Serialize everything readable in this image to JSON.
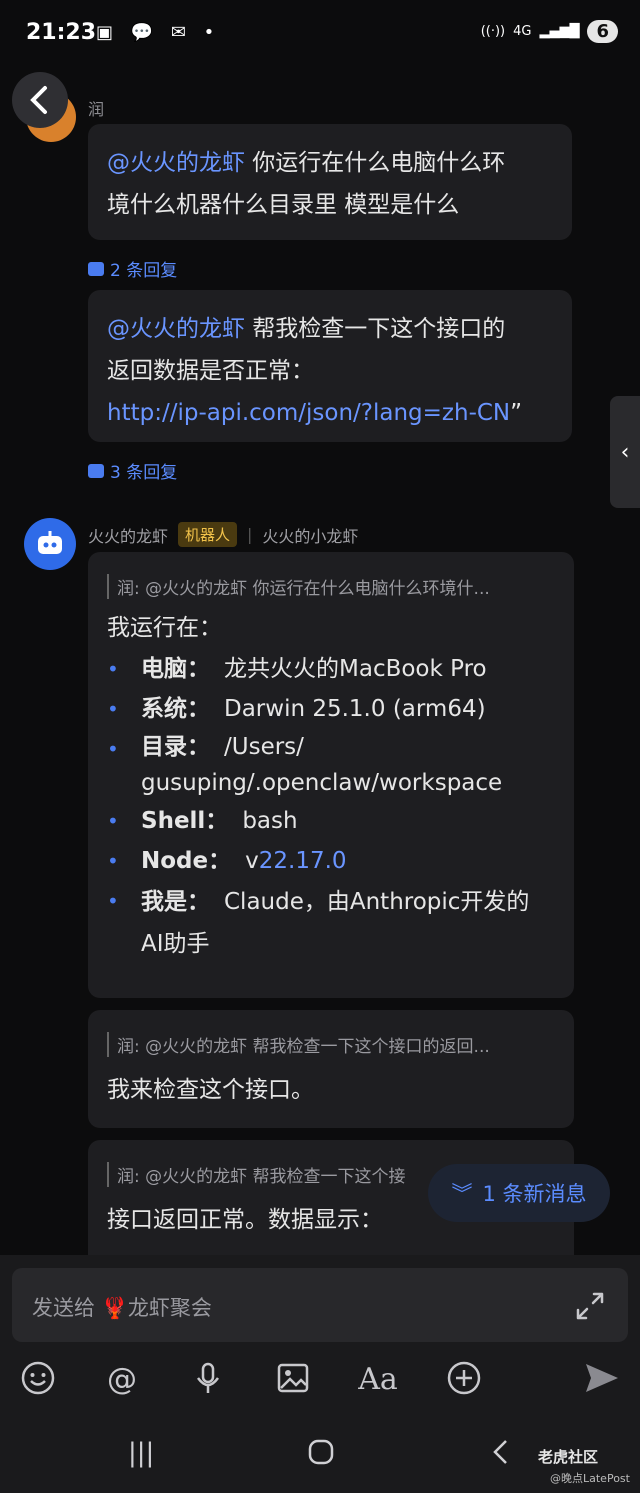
{
  "status_bar": {
    "time": "21:23",
    "network": "4G",
    "battery": "6"
  },
  "thread": {
    "top_sender": "润",
    "messages": [
      {
        "mention": "@火火的龙虾",
        "text_line1": " 你运行在什么电脑什么环",
        "text_line2": "境什么机器什么目录里 模型是什么",
        "reply_count": "2 条回复"
      },
      {
        "mention": "@火火的龙虾",
        "text_line1": " 帮我检查一下这个接口的",
        "text_line2": "返回数据是否正常：",
        "link": "http://ip-api.com/json/?lang=zh-CN",
        "link_suffix": "”",
        "reply_count": "3 条回复"
      }
    ]
  },
  "bot": {
    "name": "火火的龙虾",
    "tag": "机器人",
    "alias": "火火的小龙虾",
    "reply1": {
      "quote": "润: @火火的龙虾 你运行在什么电脑什么环境什...",
      "intro": "我运行在：",
      "items": [
        {
          "key": "电脑：",
          "value": "龙共火火的MacBook Pro"
        },
        {
          "key": "系统：",
          "value": "Darwin 25.1.0 (arm64)"
        },
        {
          "key": "目录：",
          "value": "/Users/",
          "value2": "gusuping/.openclaw/workspace"
        },
        {
          "key": "Shell：",
          "value": "bash"
        },
        {
          "key": "Node：",
          "value_prefix": "v",
          "value": "22.17.0"
        },
        {
          "key": "我是：",
          "value": "Claude，由Anthropic开发的",
          "value2": "AI助手"
        }
      ]
    },
    "reply2": {
      "quote": "润: @火火的龙虾 帮我检查一下这个接口的返回...",
      "text": "我来检查这个接口。"
    },
    "reply3": {
      "quote": "润: @火火的龙虾 帮我检查一下这个接",
      "text": "接口返回正常。数据显示："
    }
  },
  "new_messages": "1 条新消息",
  "composer": {
    "placeholder_prefix": "发送给 ",
    "placeholder_emoji": "🦞",
    "placeholder_group": "龙虾聚会"
  },
  "watermark": {
    "brand": "老虎社区",
    "credit": "@晚点LatePost"
  },
  "colors": {
    "accent": "#5b8cff",
    "bot_tag_bg": "#4a3a10",
    "bot_tag_fg": "#f1c24a",
    "background": "#0c0c0d",
    "bubble": "#1e1e21"
  }
}
